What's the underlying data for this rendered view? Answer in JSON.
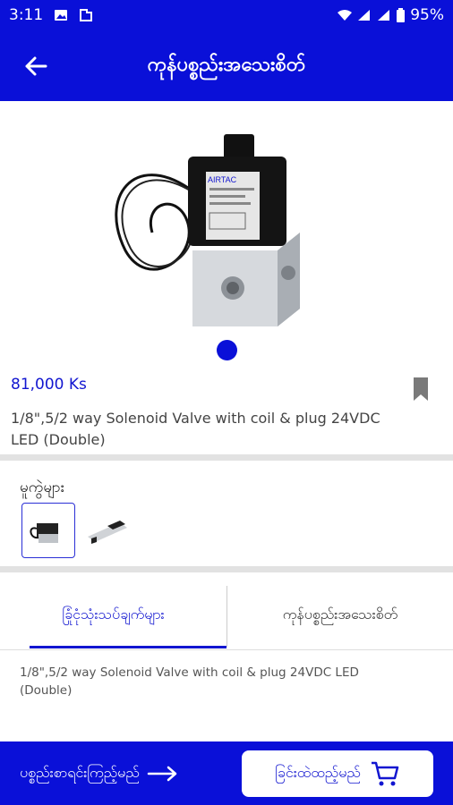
{
  "status_bar": {
    "time": "3:11",
    "battery": "95%"
  },
  "app_bar": {
    "title": "ကုန်ပစ္စည်းအသေးစိတ်"
  },
  "product": {
    "image_brand": "AIRTAC",
    "price": "81,000 Ks",
    "description": "1/8\",5/2 way Solenoid Valve with coil & plug 24VDC LED (Double)"
  },
  "variants": {
    "label": "မူကွဲများ"
  },
  "tabs": [
    {
      "label": "ခြုံငုံသုံးသပ်ချက်များ"
    },
    {
      "label": "ကုန်ပစ္စည်းအသေးစိတ်"
    }
  ],
  "detail_text": "1/8\",5/2 way Solenoid Valve with coil & plug 24VDC LED (Double)",
  "bottom_bar": {
    "list_label": "ပစ္စည်းစာရင်းကြည့်မည်",
    "cart_label": "ခြင်းထဲထည့်မည်"
  },
  "colors": {
    "primary": "#0a10d8",
    "accent_text": "#1216d0"
  }
}
